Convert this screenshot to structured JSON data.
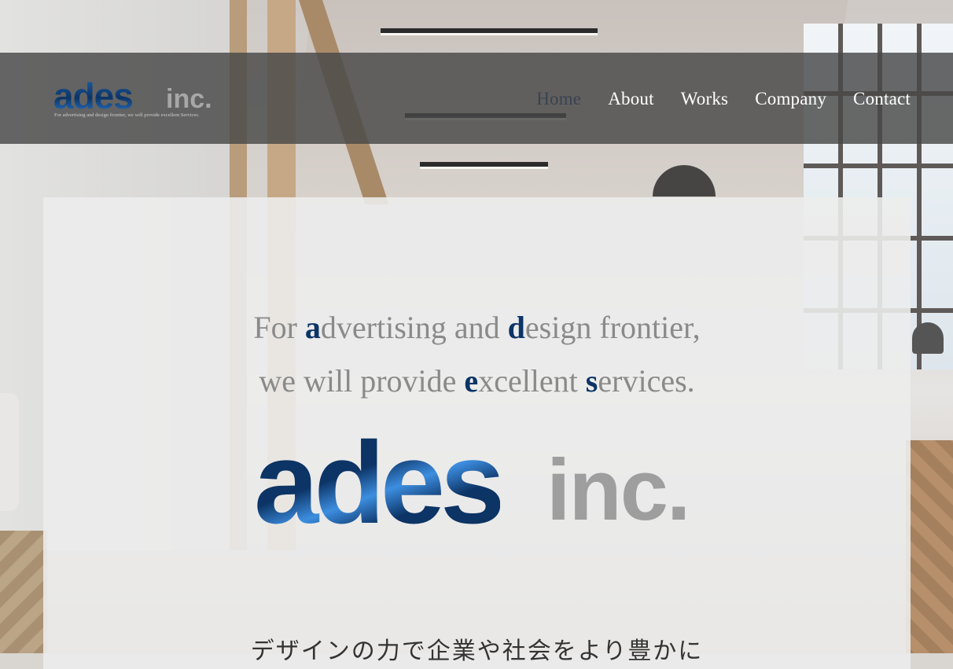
{
  "header": {
    "logo": {
      "wordmark": "ades",
      "suffix": "inc.",
      "tagline": "For advertising and design frontier, we will provide excellent Services."
    },
    "nav": [
      {
        "label": "Home",
        "active": true
      },
      {
        "label": "About",
        "active": false
      },
      {
        "label": "Works",
        "active": false
      },
      {
        "label": "Company",
        "active": false
      },
      {
        "label": "Contact",
        "active": false
      }
    ]
  },
  "hero": {
    "tagline_line1": {
      "p1": "For ",
      "h1": "a",
      "p2": "dvertising and ",
      "h2": "d",
      "p3": "esign frontier,"
    },
    "tagline_line2": {
      "p1": "we will provide ",
      "h1": "e",
      "p2": "xcellent ",
      "h2": "s",
      "p3": "ervices."
    },
    "logo": {
      "wordmark": "ades",
      "suffix": "inc."
    },
    "japanese_copy": "デザインの力で企業や社会をより豊かに"
  },
  "colors": {
    "brand_navy": "#0c3466",
    "brand_blue": "#3d8ee0",
    "logo_gray": "#9e9e9e",
    "tagline_gray": "#8a8a8a",
    "nav_active": "#3a4350",
    "nav_text": "#ffffff",
    "header_bg": "#484848"
  }
}
